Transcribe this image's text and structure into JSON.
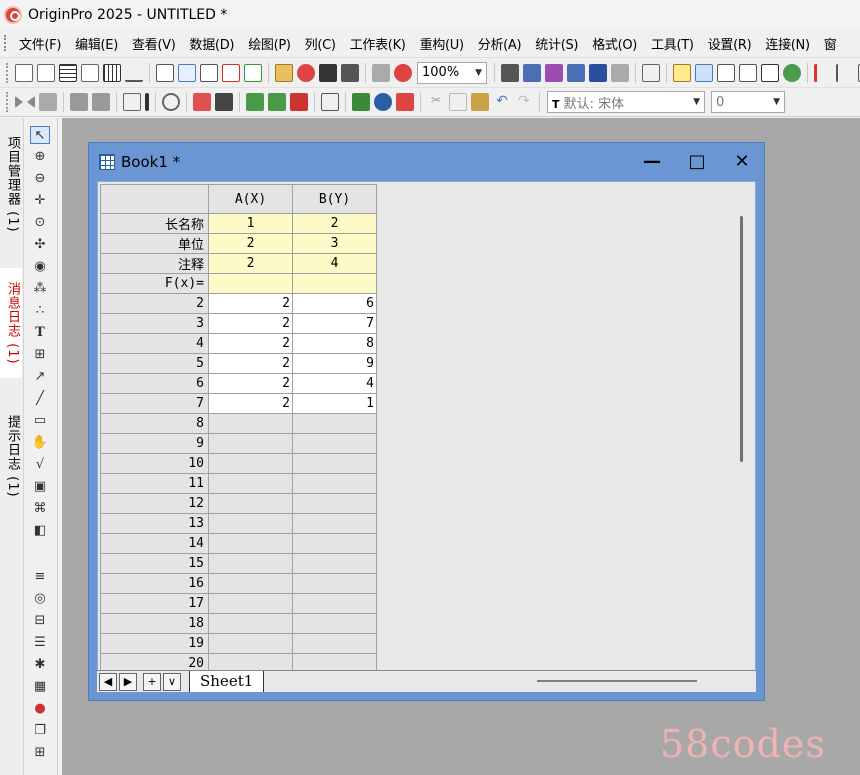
{
  "app": {
    "title": "OriginPro 2025 - UNTITLED *"
  },
  "menu": [
    "文件(F)",
    "编辑(E)",
    "查看(V)",
    "数据(D)",
    "绘图(P)",
    "列(C)",
    "工作表(K)",
    "重构(U)",
    "分析(A)",
    "统计(S)",
    "格式(O)",
    "工具(T)",
    "设置(R)",
    "连接(N)",
    "窗"
  ],
  "toolbar": {
    "zoom": "100%",
    "font_name": "默认: 宋体",
    "font_size": "0"
  },
  "left_dock": {
    "tabs": [
      "项目管理器 (1)",
      "消息日志 (1)",
      "提示日志 (1)"
    ]
  },
  "book": {
    "title": "Book1 *",
    "columns": [
      "A(X)",
      "B(Y)"
    ],
    "meta_rows": [
      {
        "label": "长名称",
        "values": [
          "1",
          "2"
        ]
      },
      {
        "label": "单位",
        "values": [
          "2",
          "3"
        ]
      },
      {
        "label": "注释",
        "values": [
          "2",
          "4"
        ]
      },
      {
        "label": "F(x)=",
        "values": [
          "",
          ""
        ]
      }
    ],
    "data_rows": [
      {
        "label": "2",
        "values": [
          "2",
          "6"
        ]
      },
      {
        "label": "3",
        "values": [
          "2",
          "7"
        ]
      },
      {
        "label": "4",
        "values": [
          "2",
          "8"
        ]
      },
      {
        "label": "5",
        "values": [
          "2",
          "9"
        ]
      },
      {
        "label": "6",
        "values": [
          "2",
          "4"
        ]
      },
      {
        "label": "7",
        "values": [
          "2",
          "1"
        ]
      },
      {
        "label": "8",
        "values": [
          "",
          ""
        ]
      },
      {
        "label": "9",
        "values": [
          "",
          ""
        ]
      },
      {
        "label": "10",
        "values": [
          "",
          ""
        ]
      },
      {
        "label": "11",
        "values": [
          "",
          ""
        ]
      },
      {
        "label": "12",
        "values": [
          "",
          ""
        ]
      },
      {
        "label": "13",
        "values": [
          "",
          ""
        ]
      },
      {
        "label": "14",
        "values": [
          "",
          ""
        ]
      },
      {
        "label": "15",
        "values": [
          "",
          ""
        ]
      },
      {
        "label": "16",
        "values": [
          "",
          ""
        ]
      },
      {
        "label": "17",
        "values": [
          "",
          ""
        ]
      },
      {
        "label": "18",
        "values": [
          "",
          ""
        ]
      },
      {
        "label": "19",
        "values": [
          "",
          ""
        ]
      },
      {
        "label": "20",
        "values": [
          "",
          ""
        ]
      }
    ],
    "sheet_tab": "Sheet1",
    "nav": [
      "◀",
      "▶",
      "+",
      "∨"
    ]
  },
  "watermark": "58codes",
  "colors": {
    "book_frame": "#6a97d4",
    "meta_bg": "#fdfac8",
    "watermark": "#f1b2b2"
  }
}
